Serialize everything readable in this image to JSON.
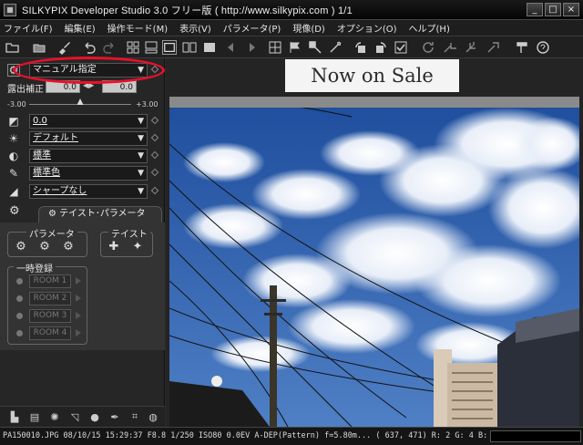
{
  "window": {
    "title": "SILKYPIX Developer Studio 3.0 フリー版 ( http://www.silkypix.com )  1/1",
    "min_glyph": "_",
    "max_glyph": "□",
    "close_glyph": "×"
  },
  "menu": [
    "ファイル(F)",
    "編集(E)",
    "操作モード(M)",
    "表示(V)",
    "パラメータ(P)",
    "現像(D)",
    "オプション(O)",
    "ヘルプ(H)"
  ],
  "panel": {
    "preset": "マニュアル指定",
    "exposure": {
      "label": "露出補正",
      "value": "0.0",
      "fine_value": "0.0",
      "min_label": "-3.00",
      "max_label": "+3.00",
      "slider_fraction": 0.5
    },
    "selects": [
      {
        "icon": "white-balance-icon",
        "value": "0.0"
      },
      {
        "icon": "sun-icon",
        "value": "デフォルト"
      },
      {
        "icon": "contrast-icon",
        "value": "標準"
      },
      {
        "icon": "eyedropper-icon",
        "value": "標準色"
      },
      {
        "icon": "sharpness-icon",
        "value": "シャープなし"
      }
    ],
    "taste_tab": "テイスト･パラメータ",
    "param_group": "パラメータ",
    "taste_group": "テイスト",
    "temp_group": "一時登録",
    "rooms": [
      "ROOM 1",
      "ROOM 2",
      "ROOM 3",
      "ROOM 4"
    ]
  },
  "viewer": {
    "banner": "Now on Sale"
  },
  "status": {
    "text": "PA150010.JPG 08/10/15 15:29:37 F8.8 1/250 ISO80   0.0EV A-DEP(Pattern) f=5.80m... ( 637,  471) R:   2  G:   4  B:   6"
  },
  "colors": {
    "highlight": "#e8102a",
    "sky": "#2b5ca8"
  }
}
